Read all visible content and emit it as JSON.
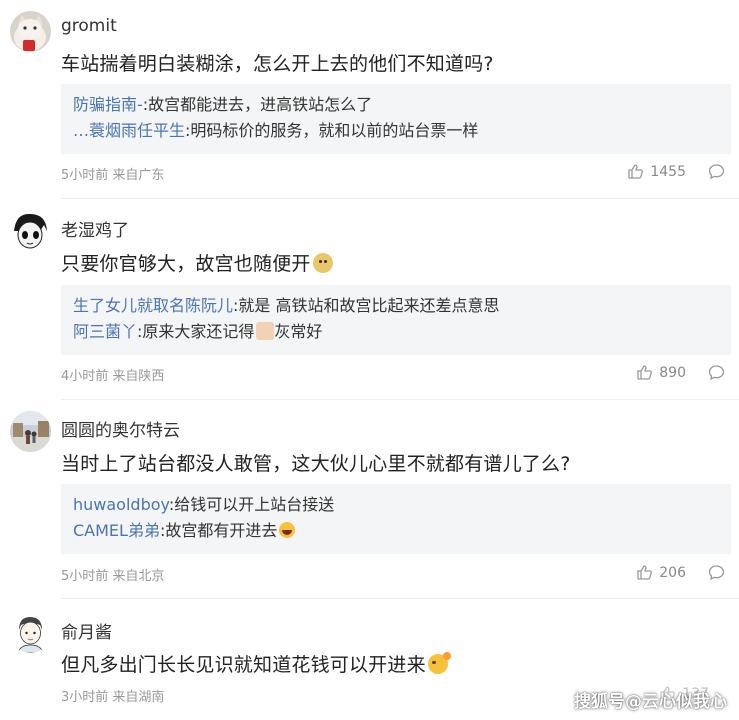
{
  "comments": [
    {
      "username": "gromit",
      "content": "车站揣着明白装糊涂，怎么开上去的他们不知道吗?",
      "replies": [
        {
          "name": "防骗指南-",
          "text": ":故宫都能进去，进高铁站怎么了"
        },
        {
          "name": "…蓑烟雨任平生",
          "text": ":明码标价的服务，就和以前的站台票一样"
        }
      ],
      "meta": "5小时前 来自广东",
      "likes": "1455",
      "avatar_icon": "cat-avatar-icon"
    },
    {
      "username": "老湿鸡了",
      "content": "只要你官够大，故宫也随便开",
      "replies": [
        {
          "name": "生了女儿就取名陈阮儿",
          "text": ":就是 高铁站和故宫比起来还差点意思"
        },
        {
          "name": "阿三菌丫",
          "text": ":原来大家还记得",
          "text_after": "灰常好"
        }
      ],
      "meta": "4小时前 来自陕西",
      "likes": "890",
      "avatar_icon": "anime-face-avatar-icon"
    },
    {
      "username": "圆圆的奥尔特云",
      "content": "当时上了站台都没人敢管，这大伙儿心里不就都有谱儿了么?",
      "replies": [
        {
          "name": "huwaoldboy",
          "text": ":给钱可以开上站台接送"
        },
        {
          "name": "CAMEL弟弟",
          "text": ":故宫都有开进去"
        }
      ],
      "meta": "5小时前 来自北京",
      "likes": "206",
      "avatar_icon": "photo-avatar-icon"
    },
    {
      "username": "俞月酱",
      "content": "但凡多出门长长见识就知道花钱可以开进来",
      "meta": "3小时前 来自湖南",
      "likes": "137",
      "avatar_icon": "cartoon-boy-avatar-icon"
    }
  ],
  "watermark": "搜狐号@云心似我心",
  "colors": {
    "reply_name": "#4a74b8",
    "reply_bg": "#f4f5f6",
    "meta": "#999999"
  }
}
